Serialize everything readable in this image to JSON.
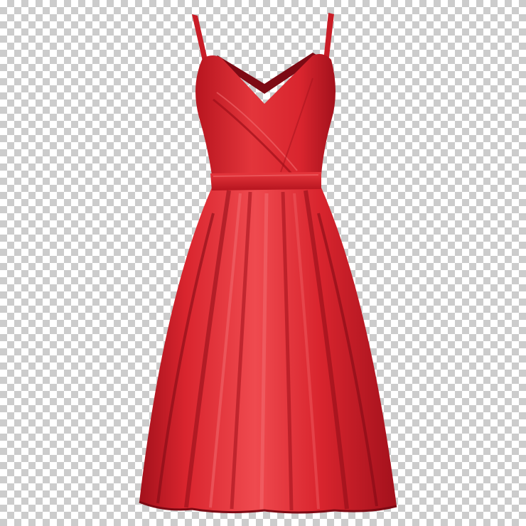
{
  "image": {
    "subject": "red-sleeveless-dress",
    "background": "transparency-checkerboard",
    "colors": {
      "dress_main": "#d9252e",
      "dress_light": "#ef4a4f",
      "dress_shadow": "#a3111c",
      "dress_deep": "#7d0a14",
      "checker_light": "#ffffff",
      "checker_dark": "#cccccc"
    }
  }
}
